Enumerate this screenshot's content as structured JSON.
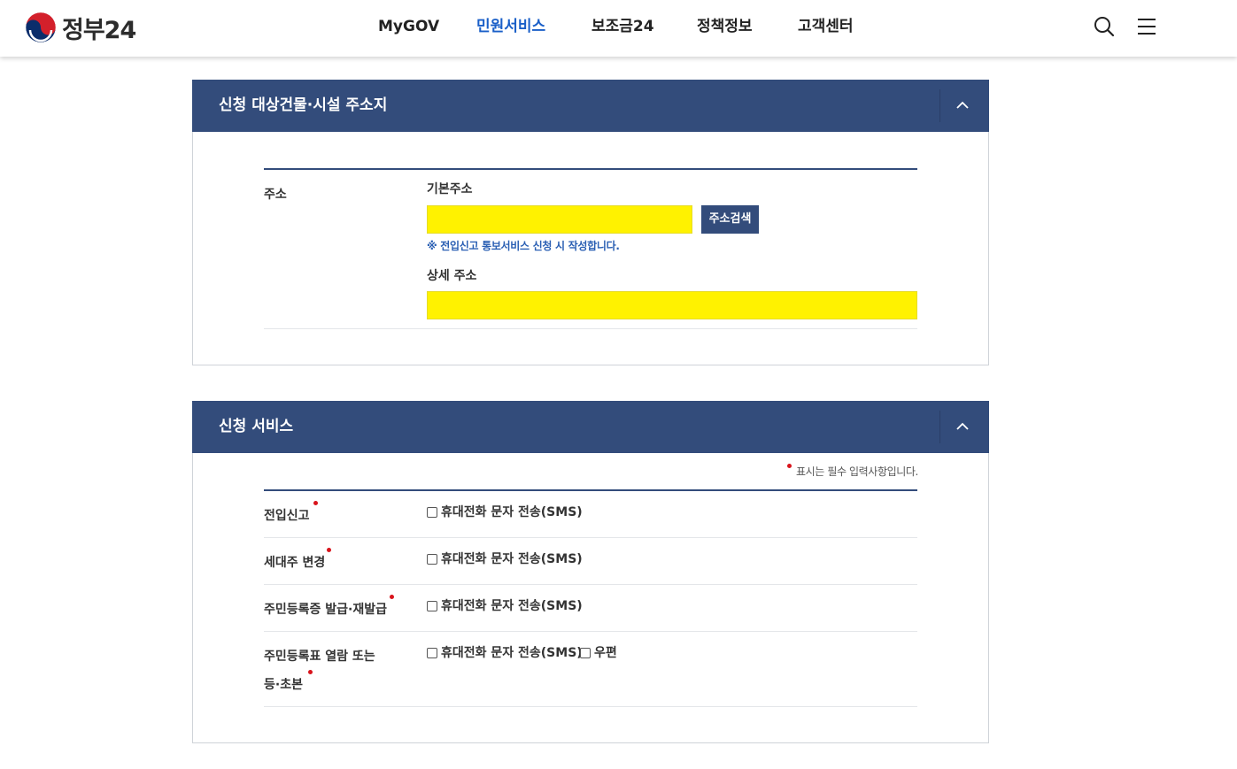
{
  "header": {
    "logo_text": "정부24",
    "nav": [
      {
        "label": "MyGOV",
        "active": false
      },
      {
        "label": "민원서비스",
        "active": true
      },
      {
        "label": "보조금24",
        "active": false
      },
      {
        "label": "정책정보",
        "active": false
      },
      {
        "label": "고객센터",
        "active": false
      }
    ],
    "icons": [
      "search-icon",
      "menu-icon"
    ]
  },
  "address_panel": {
    "title": "신청 대상건물·시설 주소지",
    "toggle_icon": "chevron-up-icon",
    "row_label": "주소",
    "basic_address_label": "기본주소",
    "basic_address_value": "",
    "search_button": "주소검색",
    "notice": "※ 전입신고 통보서비스 신청 시 작성합니다.",
    "detail_address_label": "상세 주소",
    "detail_address_value": ""
  },
  "service_panel": {
    "title": "신청 서비스",
    "toggle_icon": "chevron-up-icon",
    "required_note": "표시는 필수 입력사항입니다.",
    "rows": [
      {
        "label": "전입신고",
        "options": [
          "휴대전화 문자 전송(SMS)"
        ]
      },
      {
        "label": "세대주 변경",
        "options": [
          "휴대전화 문자 전송(SMS)"
        ]
      },
      {
        "label": "주민등록증 발급·재발급",
        "options": [
          "휴대전화 문자 전송(SMS)"
        ]
      },
      {
        "label_line1": "주민등록표 열람 또는",
        "label_line2": "등·초본",
        "options": [
          "휴대전화 문자 전송(SMS)",
          "우편"
        ]
      }
    ]
  },
  "colors": {
    "panel_header": "#334c7b",
    "input_highlight": "#fff200",
    "active_nav": "#1a5fc8",
    "required_dot": "#d9141c"
  }
}
